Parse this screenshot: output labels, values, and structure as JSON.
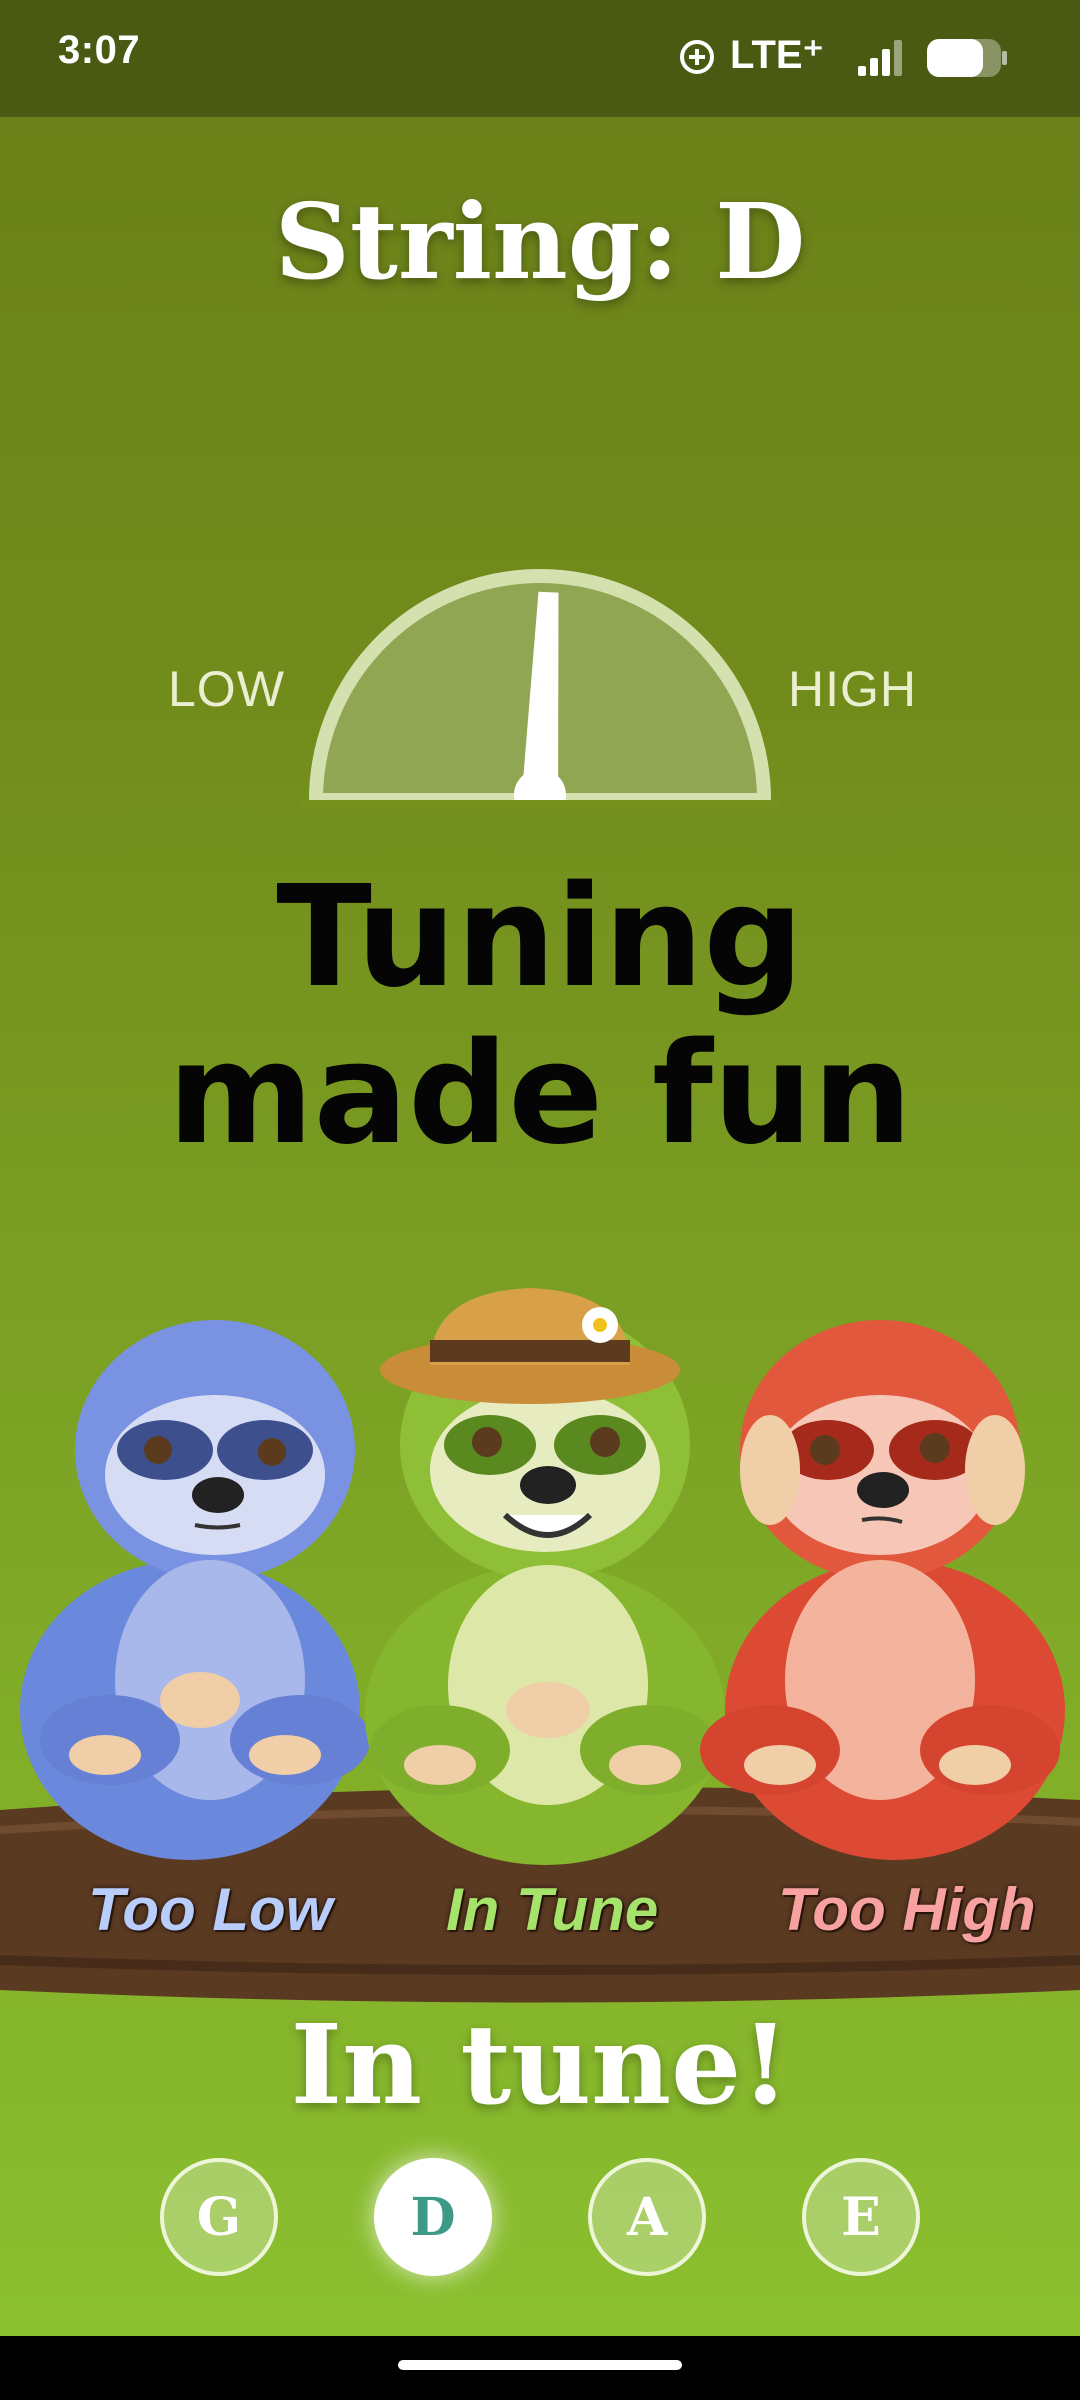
{
  "status_bar": {
    "time": "3:07",
    "network": "LTE⁺",
    "icons": [
      "sync-icon",
      "signal-icon",
      "battery-icon"
    ]
  },
  "tuner": {
    "string_title": "String: D",
    "gauge_low": "LOW",
    "gauge_high": "HIGH",
    "needle_offset_percent": 3
  },
  "tagline": {
    "line1": "Tuning",
    "line2": "made fun"
  },
  "mascots": {
    "too_low": "Too Low",
    "in_tune": "In Tune",
    "too_high": "Too High"
  },
  "status_message": "In tune!",
  "strings": [
    {
      "label": "G",
      "active": false
    },
    {
      "label": "D",
      "active": true
    },
    {
      "label": "A",
      "active": false
    },
    {
      "label": "E",
      "active": false
    }
  ],
  "colors": {
    "background_top": "#6a7f18",
    "background_bottom": "#8bc02f",
    "active_string_text": "#3e9a88",
    "too_low": "#6f8de0",
    "in_tune": "#8dbb35",
    "too_high": "#e0503a"
  }
}
